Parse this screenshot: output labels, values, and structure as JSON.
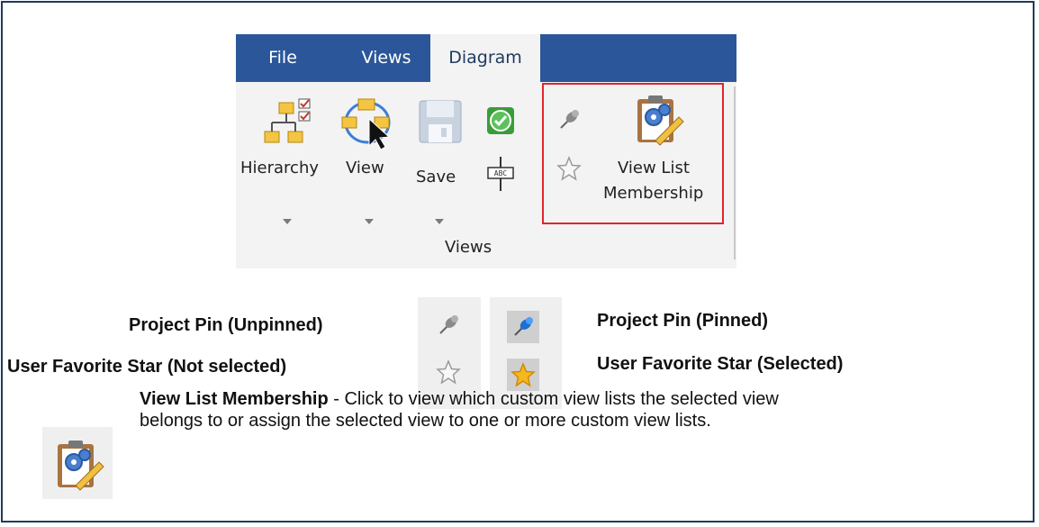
{
  "tabs": [
    {
      "label": "File",
      "active": false
    },
    {
      "label": "Views",
      "active": false
    },
    {
      "label": "Diagram",
      "active": true
    }
  ],
  "ribbon": {
    "hierarchy_label": "Hierarchy",
    "view_label": "View",
    "save_label": "Save",
    "vlm_label_1": "View List",
    "vlm_label_2": "Membership",
    "group_label": "Views"
  },
  "legend": {
    "pin_unpinned": "Project Pin (Unpinned)",
    "star_not_selected": "User Favorite Star (Not selected)",
    "pin_pinned": "Project Pin (Pinned)",
    "star_selected": "User Favorite Star (Selected)"
  },
  "description": {
    "title": "View List Membership",
    "text_line": " - Click to view which custom view lists the selected view",
    "text_line2": "belongs to or assign the selected view to one or more custom view lists."
  },
  "colors": {
    "tabbar": "#2b579a",
    "highlight": "#e0262d",
    "frame": "#1f3a5f"
  }
}
